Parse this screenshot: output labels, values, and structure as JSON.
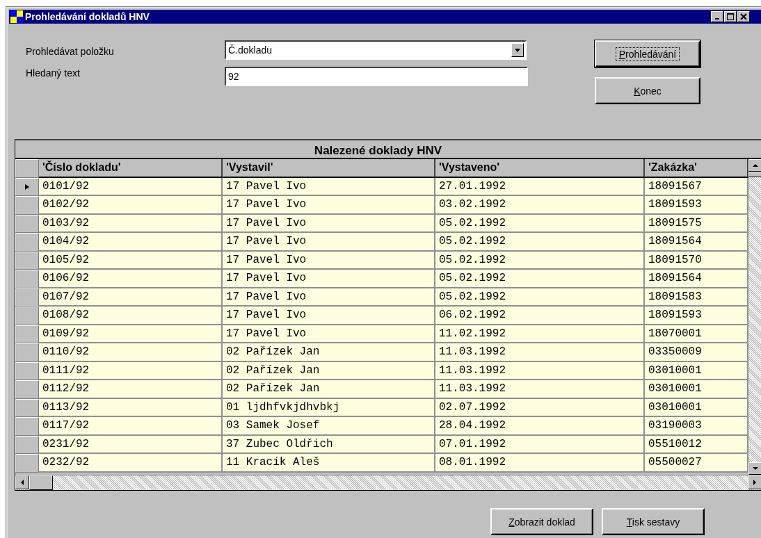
{
  "window": {
    "title": "Prohledávání dokladů HNV"
  },
  "form": {
    "field_label": "Prohledávat položku",
    "field_value": "Č.dokladu",
    "text_label": "Hledaný text",
    "text_value": "92"
  },
  "top_buttons": [
    {
      "accel": "P",
      "rest": "rohledávání",
      "focused": true
    },
    {
      "accel": "K",
      "rest": "onec",
      "focused": false
    }
  ],
  "table": {
    "caption": "Nalezené doklady HNV",
    "columns": [
      "'Číslo dokladu'",
      "'Vystavil'",
      "'Vystaveno'",
      "'Zakázka'"
    ],
    "rows": [
      {
        "selected": true,
        "cells": [
          "0101/92",
          "17 Pavel Ivo",
          "27.01.1992",
          "18091567"
        ]
      },
      {
        "selected": false,
        "cells": [
          "0102/92",
          "17 Pavel Ivo",
          "03.02.1992",
          "18091593"
        ]
      },
      {
        "selected": false,
        "cells": [
          "0103/92",
          "17 Pavel Ivo",
          "05.02.1992",
          "18091575"
        ]
      },
      {
        "selected": false,
        "cells": [
          "0104/92",
          "17 Pavel Ivo",
          "05.02.1992",
          "18091564"
        ]
      },
      {
        "selected": false,
        "cells": [
          "0105/92",
          "17 Pavel Ivo",
          "05.02.1992",
          "18091570"
        ]
      },
      {
        "selected": false,
        "cells": [
          "0106/92",
          "17 Pavel Ivo",
          "05.02.1992",
          "18091564"
        ]
      },
      {
        "selected": false,
        "cells": [
          "0107/92",
          "17 Pavel Ivo",
          "05.02.1992",
          "18091583"
        ]
      },
      {
        "selected": false,
        "cells": [
          "0108/92",
          "17 Pavel Ivo",
          "06.02.1992",
          "18091593"
        ]
      },
      {
        "selected": false,
        "cells": [
          "0109/92",
          "17 Pavel Ivo",
          "11.02.1992",
          "18070001"
        ]
      },
      {
        "selected": false,
        "cells": [
          "0110/92",
          "02 Pařízek Jan",
          "11.03.1992",
          "03350009"
        ]
      },
      {
        "selected": false,
        "cells": [
          "0111/92",
          "02 Pařízek Jan",
          "11.03.1992",
          "03010001"
        ]
      },
      {
        "selected": false,
        "cells": [
          "0112/92",
          "02 Pařízek Jan",
          "11.03.1992",
          "03010001"
        ]
      },
      {
        "selected": false,
        "cells": [
          "0113/92",
          "01 ljdhfvkjdhvbkj",
          "02.07.1992",
          "03010001"
        ]
      },
      {
        "selected": false,
        "cells": [
          "0117/92",
          "03 Samek Josef",
          "28.04.1992",
          "03190003"
        ]
      },
      {
        "selected": false,
        "cells": [
          "0231/92",
          "37 Zubec Oldřich",
          "07.01.1992",
          "05510012"
        ]
      },
      {
        "selected": false,
        "cells": [
          "0232/92",
          "11 Kracík Aleš",
          "08.01.1992",
          "05500027"
        ]
      }
    ]
  },
  "bottom_buttons": [
    {
      "accel": "Z",
      "rest": "obrazit doklad"
    },
    {
      "accel": "T",
      "rest": "isk sestavy"
    }
  ]
}
